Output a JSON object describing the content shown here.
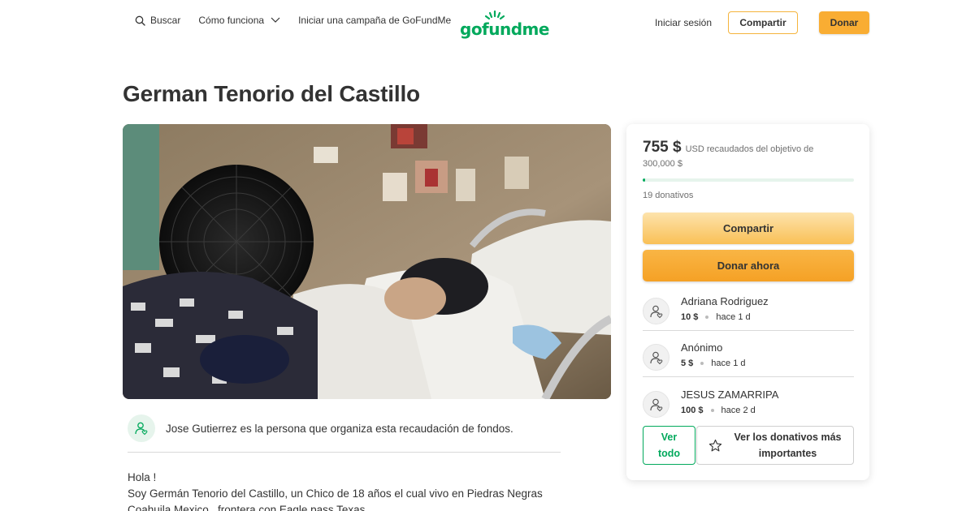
{
  "header": {
    "search_label": "Buscar",
    "how_it_works_label": "Cómo funciona",
    "start_campaign_label": "Iniciar una campaña de GoFundMe",
    "logo_text": "gofundme",
    "signin_label": "Iniciar sesión",
    "share_label": "Compartir",
    "donate_label": "Donar",
    "brand_color": "#02a95c",
    "accent_color": "#f9ad33"
  },
  "campaign": {
    "title": "German Tenorio del Castillo",
    "organizer_text": "Jose Gutierrez es la persona que organiza esta recaudación de fondos.",
    "story_lines": [
      "Hola !",
      "Soy Germán Tenorio del Castillo, un Chico de 18 años el cual vivo en Piedras Negras",
      "Coahuila Mexico , frontera con Eagle pass Texas"
    ]
  },
  "sidebar": {
    "amount": "755 $",
    "raised_text": "USD recaudados del objetivo de 300,000 $",
    "progress_fraction": 0.0025,
    "donation_count": "19 donativos",
    "share_label": "Compartir",
    "donate_label": "Donar ahora",
    "donations": [
      {
        "name": "Adriana Rodriguez",
        "amount": "10 $",
        "time": "hace 1 d"
      },
      {
        "name": "Anónimo",
        "amount": "5 $",
        "time": "hace 1 d"
      },
      {
        "name": "JESUS ZAMARRIPA",
        "amount": "100 $",
        "time": "hace 2 d"
      }
    ],
    "see_all_line1": "Ver",
    "see_all_line2": "todo",
    "top_donations_line1": "Ver los donativos más",
    "top_donations_line2": "importantes"
  },
  "icons": {
    "search": "search-icon",
    "chevron": "chevron-down-icon",
    "logo_sun": "sun-logo-icon",
    "person": "person-heart-icon",
    "star": "star-icon"
  }
}
